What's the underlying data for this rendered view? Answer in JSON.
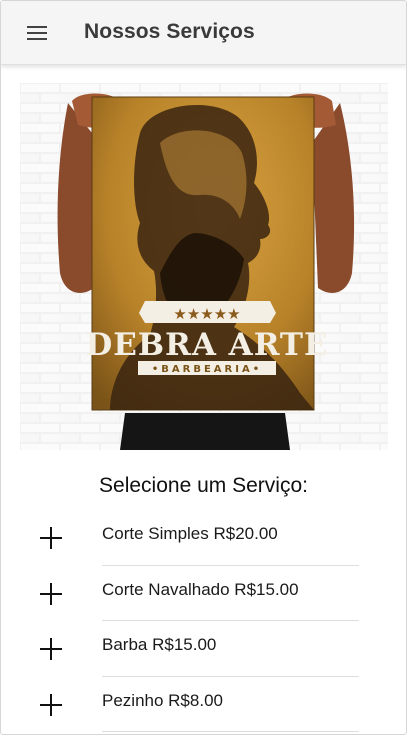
{
  "app_bar": {
    "menu_icon": "hamburger-menu-icon",
    "title": "Nossos Serviços"
  },
  "hero": {
    "logo_stars": "★★★★★",
    "logo_name": "DEBRA ARTE",
    "logo_tagline": "•BARBEARIA•"
  },
  "services": {
    "heading": "Selecione um Serviço:",
    "add_icon": "plus-icon",
    "items": [
      {
        "label": "Corte Simples R$20.00"
      },
      {
        "label": "Corte Navalhado R$15.00"
      },
      {
        "label": "Barba R$15.00"
      },
      {
        "label": "Pezinho R$8.00"
      }
    ]
  },
  "colors": {
    "app_bar_bg": "#f5f5f5",
    "poster_gold": "#c8902e",
    "text": "#212121"
  }
}
